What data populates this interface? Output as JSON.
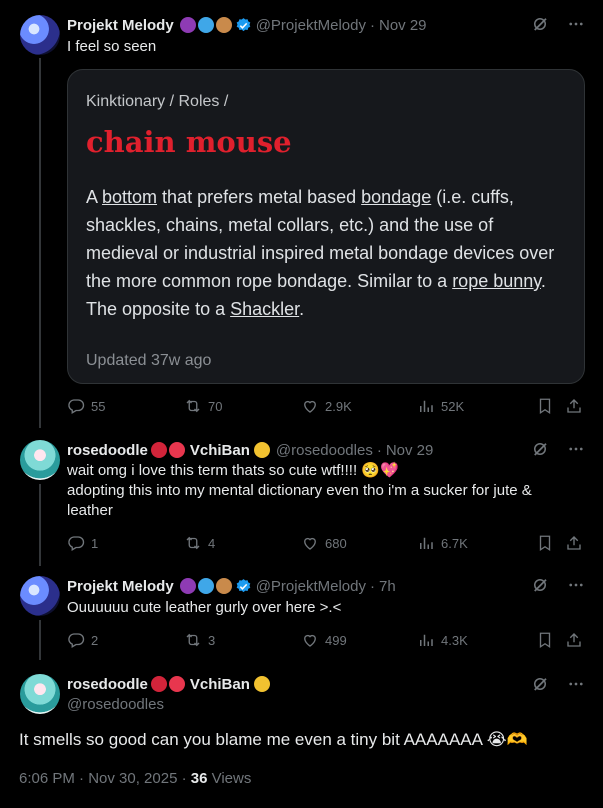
{
  "tweets": [
    {
      "name": "Projekt Melody",
      "handle": "@ProjektMelody",
      "time": "Nov 29",
      "text": "I feel so seen",
      "card": {
        "breadcrumb": "Kinktionary / Roles /",
        "term": "chain mouse",
        "def_parts": [
          "A ",
          "bottom",
          " that prefers metal based ",
          "bondage",
          " (i.e. cuffs, shackles, chains, metal collars, etc.) and the use of medieval or industrial inspired metal bondage devices over the more common rope bondage. Similar to a ",
          "rope bunny",
          ". The opposite to a ",
          "Shackler",
          "."
        ],
        "updated": "Updated 37w ago"
      },
      "replies": "55",
      "reposts": "70",
      "likes": "2.9K",
      "views": "52K"
    },
    {
      "name": "rosedoodle",
      "name2": "VchiBan",
      "handle": "@rosedoodles",
      "time": "Nov 29",
      "text": "wait omg i love this term thats so cute wtf!!!! 🥺💖",
      "text2": "adopting this into my mental dictionary even tho i'm a sucker for jute & leather",
      "replies": "1",
      "reposts": "4",
      "likes": "680",
      "views": "6.7K"
    },
    {
      "name": "Projekt Melody",
      "handle": "@ProjektMelody",
      "time": "7h",
      "text": "Ouuuuuu cute leather gurly over here >.<",
      "replies": "2",
      "reposts": "3",
      "likes": "499",
      "views": "4.3K"
    }
  ],
  "main": {
    "name": "rosedoodle",
    "name2": "VchiBan",
    "handle": "@rosedoodles",
    "text": "It smells so good can you blame me even a tiny bit AAAAAAA 😭🫶",
    "date": "6:06 PM · Nov 30, 2025 · ",
    "views_count": "36",
    "views_label": " Views"
  },
  "colors": {
    "accent": "#1d9bf0",
    "muted": "#71767b",
    "term": "#e0202d"
  }
}
